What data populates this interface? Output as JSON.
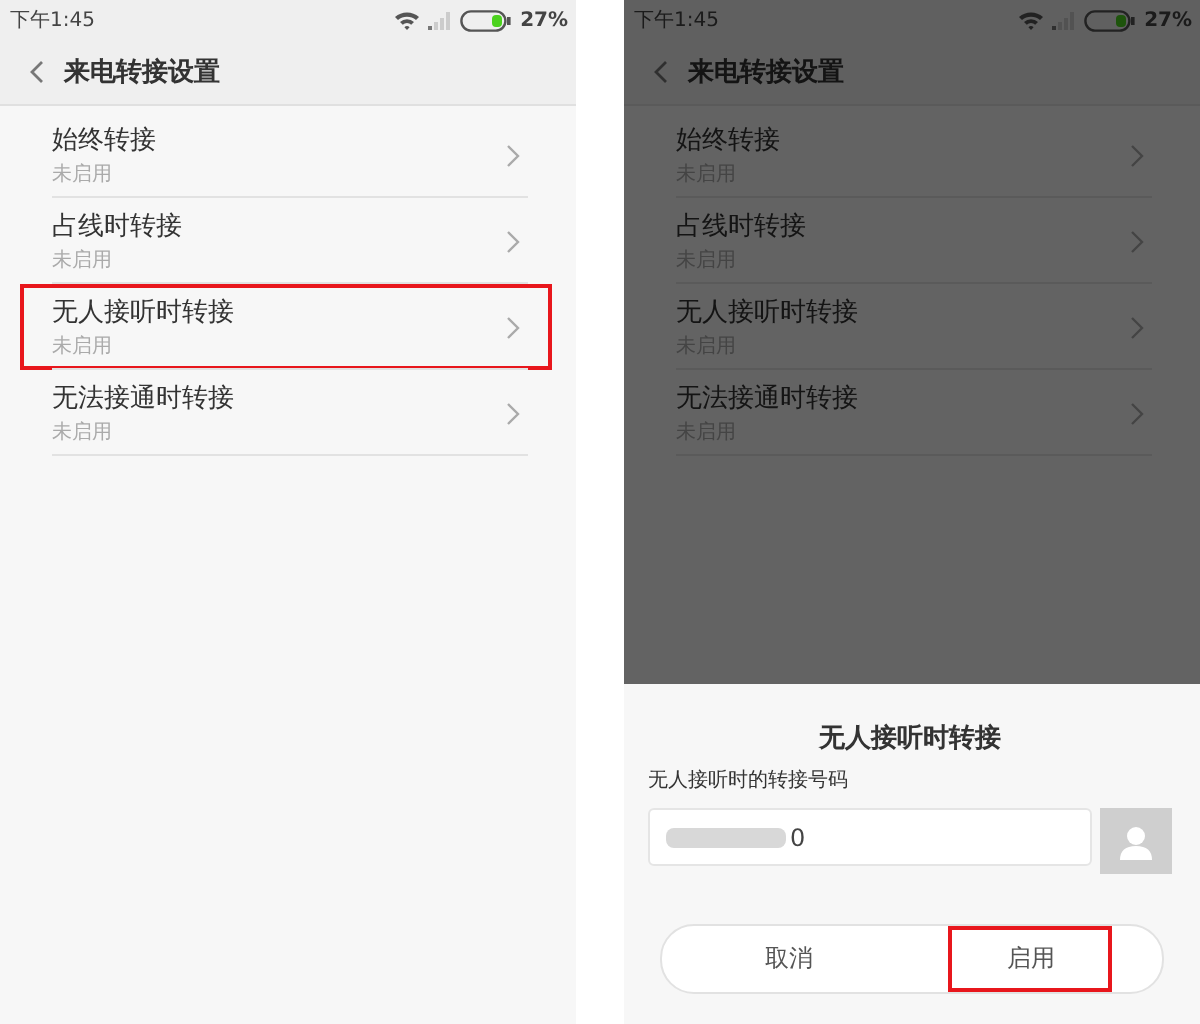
{
  "screens": [
    {
      "dimmed": false,
      "status_bar": {
        "time": "下午1:45",
        "battery": "27%"
      },
      "header": {
        "title": "来电转接设置"
      },
      "items": [
        {
          "title": "始终转接",
          "status": "未启用",
          "highlighted": false
        },
        {
          "title": "占线时转接",
          "status": "未启用",
          "highlighted": false
        },
        {
          "title": "无人接听时转接",
          "status": "未启用",
          "highlighted": true
        },
        {
          "title": "无法接通时转接",
          "status": "未启用",
          "highlighted": false
        }
      ]
    },
    {
      "dimmed": true,
      "status_bar": {
        "time": "下午1:45",
        "battery": "27%"
      },
      "header": {
        "title": "来电转接设置"
      },
      "items": [
        {
          "title": "始终转接",
          "status": "未启用",
          "highlighted": false
        },
        {
          "title": "占线时转接",
          "status": "未启用",
          "highlighted": false
        },
        {
          "title": "无人接听时转接",
          "status": "未启用",
          "highlighted": false
        },
        {
          "title": "无法接通时转接",
          "status": "未启用",
          "highlighted": false
        }
      ],
      "dialog": {
        "title": "无人接听时转接",
        "label": "无人接听时的转接号码",
        "value": "0",
        "buttons": [
          {
            "label": "取消",
            "highlighted": false
          },
          {
            "label": "启用",
            "highlighted": true
          }
        ]
      }
    }
  ]
}
